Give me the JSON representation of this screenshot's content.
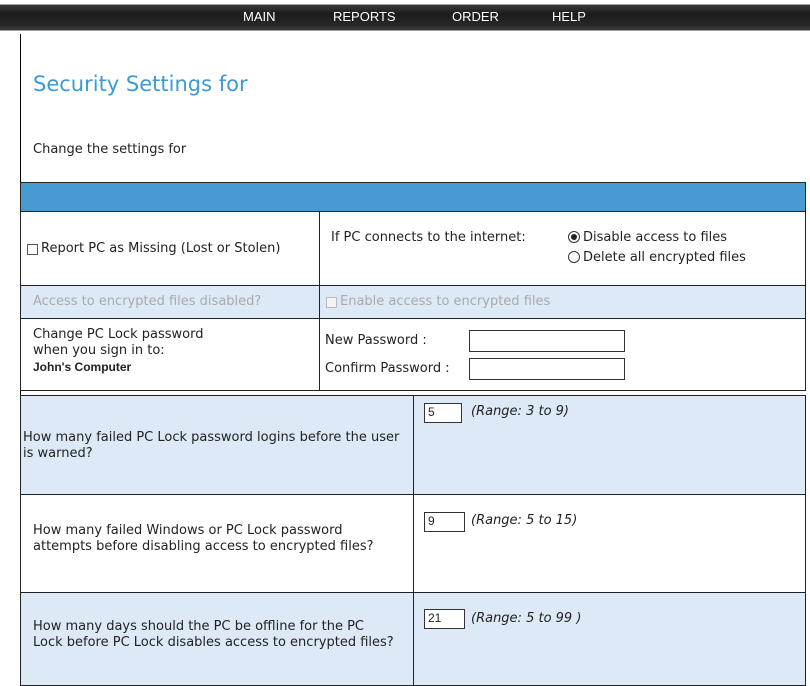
{
  "nav": {
    "main": "MAIN",
    "reports": "REPORTS",
    "order": "ORDER",
    "help": "HELP"
  },
  "page": {
    "title": "Security Settings for",
    "subtitle": "Change the settings for"
  },
  "missing": {
    "report_label": "Report PC as Missing (Lost or Stolen)",
    "report_checked": false,
    "internet_label": "If PC connects to the internet:",
    "option_disable": "Disable access to files",
    "option_delete": "Delete all encrypted files",
    "selected": "Disable access to files"
  },
  "access": {
    "question": "Access to encrypted files disabled?",
    "enable_label": "Enable access to encrypted files"
  },
  "password": {
    "line1": "Change PC Lock password",
    "line2": "when you sign in to:",
    "computer": "John's Computer",
    "new_label": "New Password :",
    "confirm_label": "Confirm Password :",
    "new_value": "",
    "confirm_value": ""
  },
  "settings": [
    {
      "question": "How many failed PC Lock password logins before the user is warned?",
      "value": "5",
      "range": "(Range: 3 to 9)"
    },
    {
      "question": "How many failed Windows or PC Lock password attempts before disabling access to encrypted files?",
      "value": "9",
      "range": "(Range: 5 to 15)"
    },
    {
      "question": "How many days should the PC be offline for the PC Lock before PC Lock disables access to encrypted files?",
      "value": "21",
      "range": "(Range: 5 to 99 )"
    }
  ],
  "colors": {
    "header_band": "#479bd2",
    "title": "#3a9bd5",
    "light_row": "#dde9f6"
  }
}
